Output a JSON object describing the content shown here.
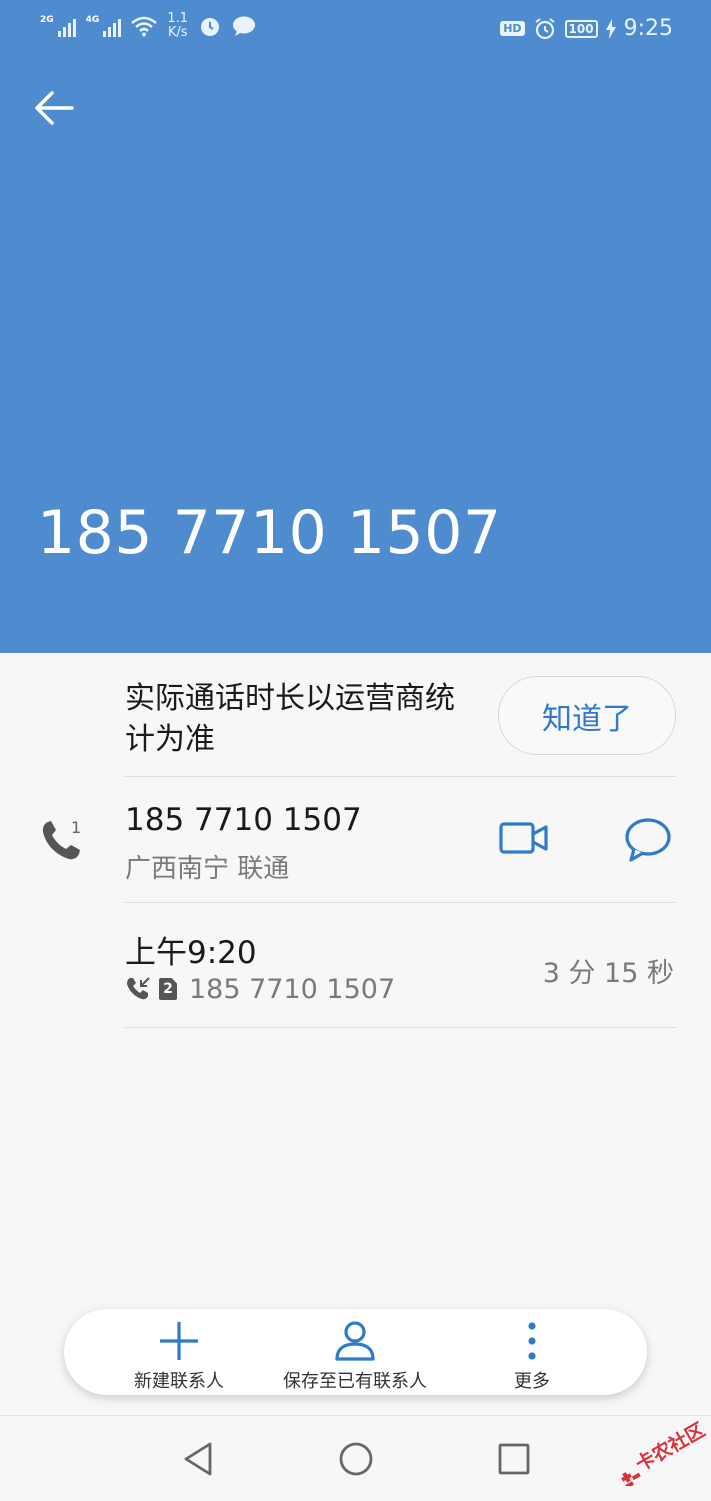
{
  "status_bar": {
    "signal_1": "2G",
    "signal_2": "4G",
    "speed_value": "1.1",
    "speed_unit": "K/s",
    "hd": "HD",
    "battery": "100",
    "time": "9:25",
    "icons": [
      "signal-icon",
      "wifi-icon",
      "alarm-icon",
      "chat-icon",
      "alarm-icon",
      "battery-icon",
      "charging-icon"
    ]
  },
  "header": {
    "phone_number": "185 7710 1507",
    "background_color": "#4f8ccf"
  },
  "notice": {
    "text": "实际通话时长以运营商统计为准",
    "button_label": "知道了"
  },
  "contact_row": {
    "sim_index": "1",
    "number": "185 7710 1507",
    "location": "广西南宁 联通"
  },
  "call_log": {
    "time": "上午9:20",
    "sim": "2",
    "number": "185 7710 1507",
    "duration": "3 分 15 秒"
  },
  "actions": {
    "new_contact": "新建联系人",
    "save_existing": "保存至已有联系人",
    "more": "更多"
  },
  "accent_color": "#2f7ac9",
  "watermark_text": "卡农社区"
}
